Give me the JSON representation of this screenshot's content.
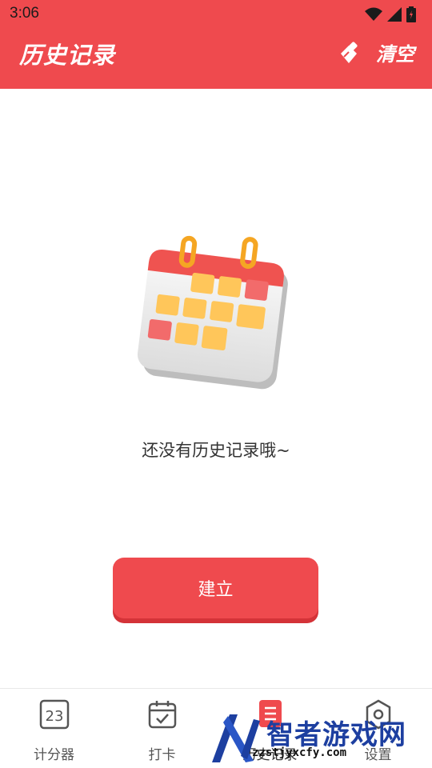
{
  "status_bar": {
    "time": "3:06"
  },
  "header": {
    "title": "历史记录",
    "clear_label": "清空",
    "bg_color": "#ef4a4e"
  },
  "empty_state": {
    "message": "还没有历史记录哦~",
    "create_label": "建立"
  },
  "bottom_nav": {
    "items": [
      {
        "label": "计分器",
        "icon": "scoreboard-icon",
        "icon_text": "23"
      },
      {
        "label": "打卡",
        "icon": "calendar-check-icon"
      },
      {
        "label": "历史记录",
        "icon": "history-doc-icon",
        "active": true
      },
      {
        "label": "设置",
        "icon": "settings-icon"
      }
    ]
  },
  "watermark": {
    "text": "智者游戏网",
    "sub": "zzstjyxcfy.com"
  }
}
